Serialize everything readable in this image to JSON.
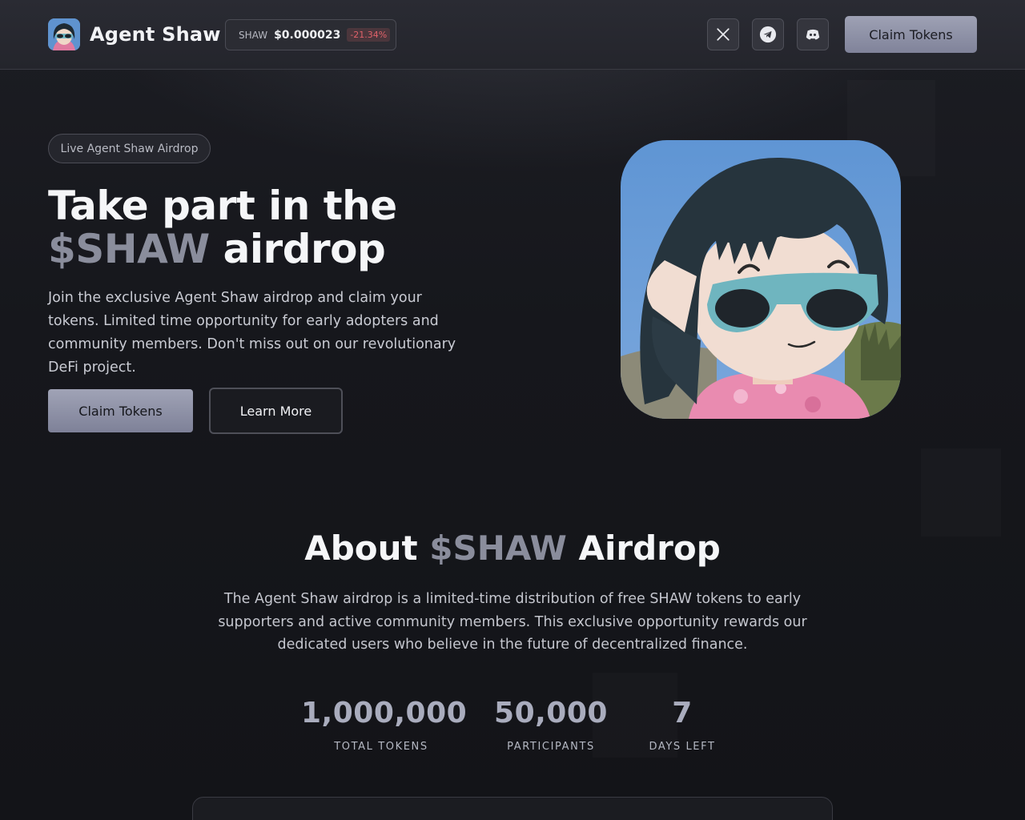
{
  "header": {
    "brand": "Agent Shaw",
    "ticker": {
      "symbol": "SHAW",
      "price": "$0.000023",
      "change": "-21.34%"
    },
    "social": [
      {
        "name": "x-icon"
      },
      {
        "name": "telegram-icon"
      },
      {
        "name": "discord-icon"
      }
    ],
    "cta_label": "Claim Tokens"
  },
  "hero": {
    "badge": "Live Agent Shaw Airdrop",
    "title_line1": "Take part in the",
    "title_highlight": "$SHAW",
    "title_rest": " airdrop",
    "description": "Join the exclusive Agent Shaw airdrop and claim your tokens. Limited time opportunity for early adopters and community members. Don't miss out on our revolutionary DeFi project.",
    "primary_label": "Claim Tokens",
    "secondary_label": "Learn More"
  },
  "about": {
    "title_prefix": "About ",
    "title_highlight": "$SHAW",
    "title_suffix": " Airdrop",
    "description": "The Agent Shaw airdrop is a limited-time distribution of free SHAW tokens to early supporters and active community members. This exclusive opportunity rewards our dedicated users who believe in the future of decentralized finance.",
    "stats": [
      {
        "value": "1,000,000",
        "label": "TOTAL TOKENS"
      },
      {
        "value": "50,000",
        "label": "PARTICIPANTS"
      },
      {
        "value": "7",
        "label": "DAYS LEFT"
      }
    ]
  },
  "colors": {
    "background": "#15161b",
    "accent": "#8a8d9c",
    "primary_button": "#9ea1b4",
    "negative": "#e0626a"
  }
}
